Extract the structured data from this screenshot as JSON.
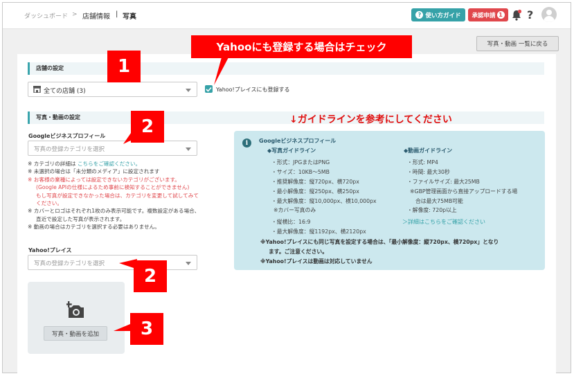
{
  "breadcrumb": {
    "dashboard": "ダッシュボード",
    "separator": ">",
    "store_info": "店舗情報",
    "divider": "|",
    "current": "写真"
  },
  "header": {
    "guide_label": "使い方ガイド",
    "guide_icon": "?",
    "approval_label": "承認申請",
    "approval_count": "1",
    "help_icon": "?"
  },
  "list_button": "写真・動画 一覧に戻る",
  "store_section": {
    "title": "店舗の設定",
    "select_value": "全ての店舗 (3)",
    "checkbox_label": "Yahoo!プレイスにも登録する",
    "checkbox_checked": true
  },
  "media_section": {
    "title": "写真・動画の設定",
    "google_label": "Googleビジネスプロフィール",
    "google_placeholder": "写真の登録カテゴリを選択",
    "notes": [
      {
        "text": "※ カテゴリの詳細は ",
        "link": "こちらをご確認ください。",
        "style": "normal"
      },
      {
        "text": "※ 未選択の場合は「未分類のメディア」に設定されます",
        "style": "normal"
      },
      {
        "text": "※ お客様の業種によっては設定できないカテゴリがございます。",
        "style": "red"
      },
      {
        "text": "(Google APIの仕様によるため事前に検知することができません)",
        "style": "red"
      },
      {
        "text": "もし写真が設定できなかった場合は、カテゴリを変更して試してみて",
        "style": "red"
      },
      {
        "text": "ください。",
        "style": "red"
      },
      {
        "text": "※ カバーとロゴはそれぞれ1枚のみ表示可能です。複数設定がある場合、",
        "style": "normal"
      },
      {
        "text": "直近で設定した写真が表示されます。",
        "style": "normal"
      },
      {
        "text": "※ 動画の場合はカテゴリを選択する必要はありません。",
        "style": "normal"
      }
    ],
    "yahoo_label": "Yahoo!プレイス",
    "yahoo_placeholder": "写真の登録カテゴリを選択",
    "add_button": "写真・動画を追加"
  },
  "guideline": {
    "heading": "↓ガイドラインを参考にしてください",
    "title": "Googleビジネスプロフィール",
    "photo_head": "◆写真ガイドライン",
    "photo_items": [
      "・形式：JPGまたはPNG",
      "・サイズ：10KB〜5MB",
      "・推奨解像度：縦720px、横720px",
      "・最小解像度：縦250px、横250px",
      "・最大解像度：縦10,000px、横10,000px",
      "※カバー写真のみ",
      "・縦横比：16:9",
      "・最大解像度：縦1192px、横2120px"
    ],
    "video_head": "◆動画ガイドライン",
    "video_items": [
      "・形式: MP4",
      "・時間: 最大30秒",
      "・ファイルサイズ: 最大25MB",
      "※GBP管理画面から直接アップロードする場",
      "合は最大75MB可能",
      "・解像度: 720p以上"
    ],
    "details_link": "＞詳細はこちらをご確認ください",
    "yahoo_note_1": "※Yahoo!プレイスにも同じ写真を設定する場合は、「最小解像度：縦720px、横720px」となり",
    "yahoo_note_2": "ます。ご注意ください。",
    "yahoo_note_3": "※Yahoo!プレイスは動画は対応していません"
  },
  "annotations": {
    "yahoo_callout": "Yahooにも登録する場合はチェック",
    "n1": "1",
    "n2a": "2",
    "n2b": "2",
    "n3": "3"
  },
  "colors": {
    "accent": "#36a2a8",
    "danger": "#e0474c",
    "callout": "#ff0000",
    "guide_bg": "#cce8ee"
  }
}
